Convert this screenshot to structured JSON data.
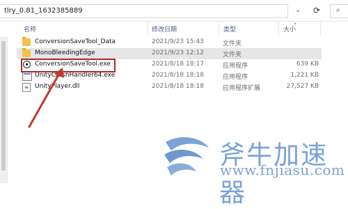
{
  "address_bar": {
    "path": "tlry_0.81_1632385889",
    "dropdown_icon": "chevron-down",
    "refresh_icon": "refresh",
    "search_icon": "search"
  },
  "columns": {
    "name": "名称",
    "date": "修改日期",
    "type": "类型",
    "size": "大小"
  },
  "files": [
    {
      "name": "ConversionSaveTool_Data",
      "date": "2021/9/23 15:43",
      "type": "文件夹",
      "size": "",
      "icon": "folder",
      "selected": false
    },
    {
      "name": "MonoBleedingEdge",
      "date": "2021/9/23 12:12",
      "type": "文件夹",
      "size": "",
      "icon": "folder",
      "selected": true
    },
    {
      "name": "ConversionSaveTool.exe",
      "date": "2021/8/18 18:17",
      "type": "应用程序",
      "size": "639 KB",
      "icon": "unity",
      "selected": false
    },
    {
      "name": "UnityCrashHandler64.exe",
      "date": "2021/8/18 18:18",
      "type": "应用程序",
      "size": "1,221 KB",
      "icon": "exe",
      "selected": false
    },
    {
      "name": "UnityPlayer.dll",
      "date": "2021/8/18 18:18",
      "type": "应用程序扩展",
      "size": "27,527 KB",
      "icon": "dll",
      "selected": false
    }
  ],
  "colors": {
    "highlight_box": "#b0282b",
    "arrow": "#c0392b",
    "watermark": "#7ba3d6"
  },
  "watermark": {
    "title": "斧牛加速器",
    "url": "www.fnjiasu.com"
  }
}
